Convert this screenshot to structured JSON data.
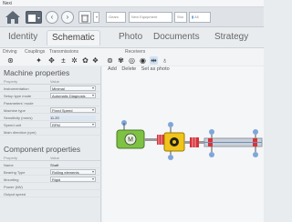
{
  "window": {
    "title": "Nexi"
  },
  "toolbar": {
    "box1": "Gears",
    "box2": "Nexi Equipment",
    "box3": "Sho",
    "box4": "All"
  },
  "tabs": [
    {
      "label": "Identity"
    },
    {
      "label": "Schematic"
    },
    {
      "label": "Photo"
    },
    {
      "label": "Documents"
    },
    {
      "label": "Strategy"
    }
  ],
  "subtabs": {
    "driving": "Driving",
    "couplings": "Couplings",
    "transmissions": "Transmissions",
    "receivers": "Receivers"
  },
  "canvas_actions": {
    "add": "Add",
    "delete": "Delete",
    "set_as_photo": "Set as photo"
  },
  "machine_properties": {
    "title": "Machine properties",
    "header_property": "Property",
    "header_value": "Value",
    "rows": [
      {
        "key": "Instrumentation",
        "value": "Minimal",
        "select": true
      },
      {
        "key": "Setup type mode",
        "value": "Automatic Diagnosis",
        "select": true
      },
      {
        "key": "Parameters' mode",
        "value": "",
        "select": false
      },
      {
        "key": "Machine type",
        "value": "Fixed Speed",
        "select": true
      },
      {
        "key": "Sensitivity (mm/s)",
        "value": "11.20",
        "select": false
      },
      {
        "key": "Speed unit",
        "value": "RPM",
        "select": true
      },
      {
        "key": "Main direction (rpm)",
        "value": "",
        "select": false
      }
    ]
  },
  "component_properties": {
    "title": "Component properties",
    "header_property": "Property",
    "header_value": "Value",
    "rows": [
      {
        "key": "Name",
        "value": "Shaft",
        "select": false
      },
      {
        "key": "Bearing Type",
        "value": "Rolling elements",
        "select": true
      },
      {
        "key": "Mounting",
        "value": "Rigid",
        "select": true
      },
      {
        "key": "Power (kW)",
        "value": "",
        "select": false
      },
      {
        "key": "Output speed",
        "value": "",
        "select": false
      }
    ]
  },
  "motor_label": "M",
  "colors": {
    "motor": "#7dc243",
    "gearbox": "#f0c419",
    "coupling": "#d9323a",
    "shaft_bar": "#c9cfd6",
    "bearing": "#7fa6d9"
  }
}
